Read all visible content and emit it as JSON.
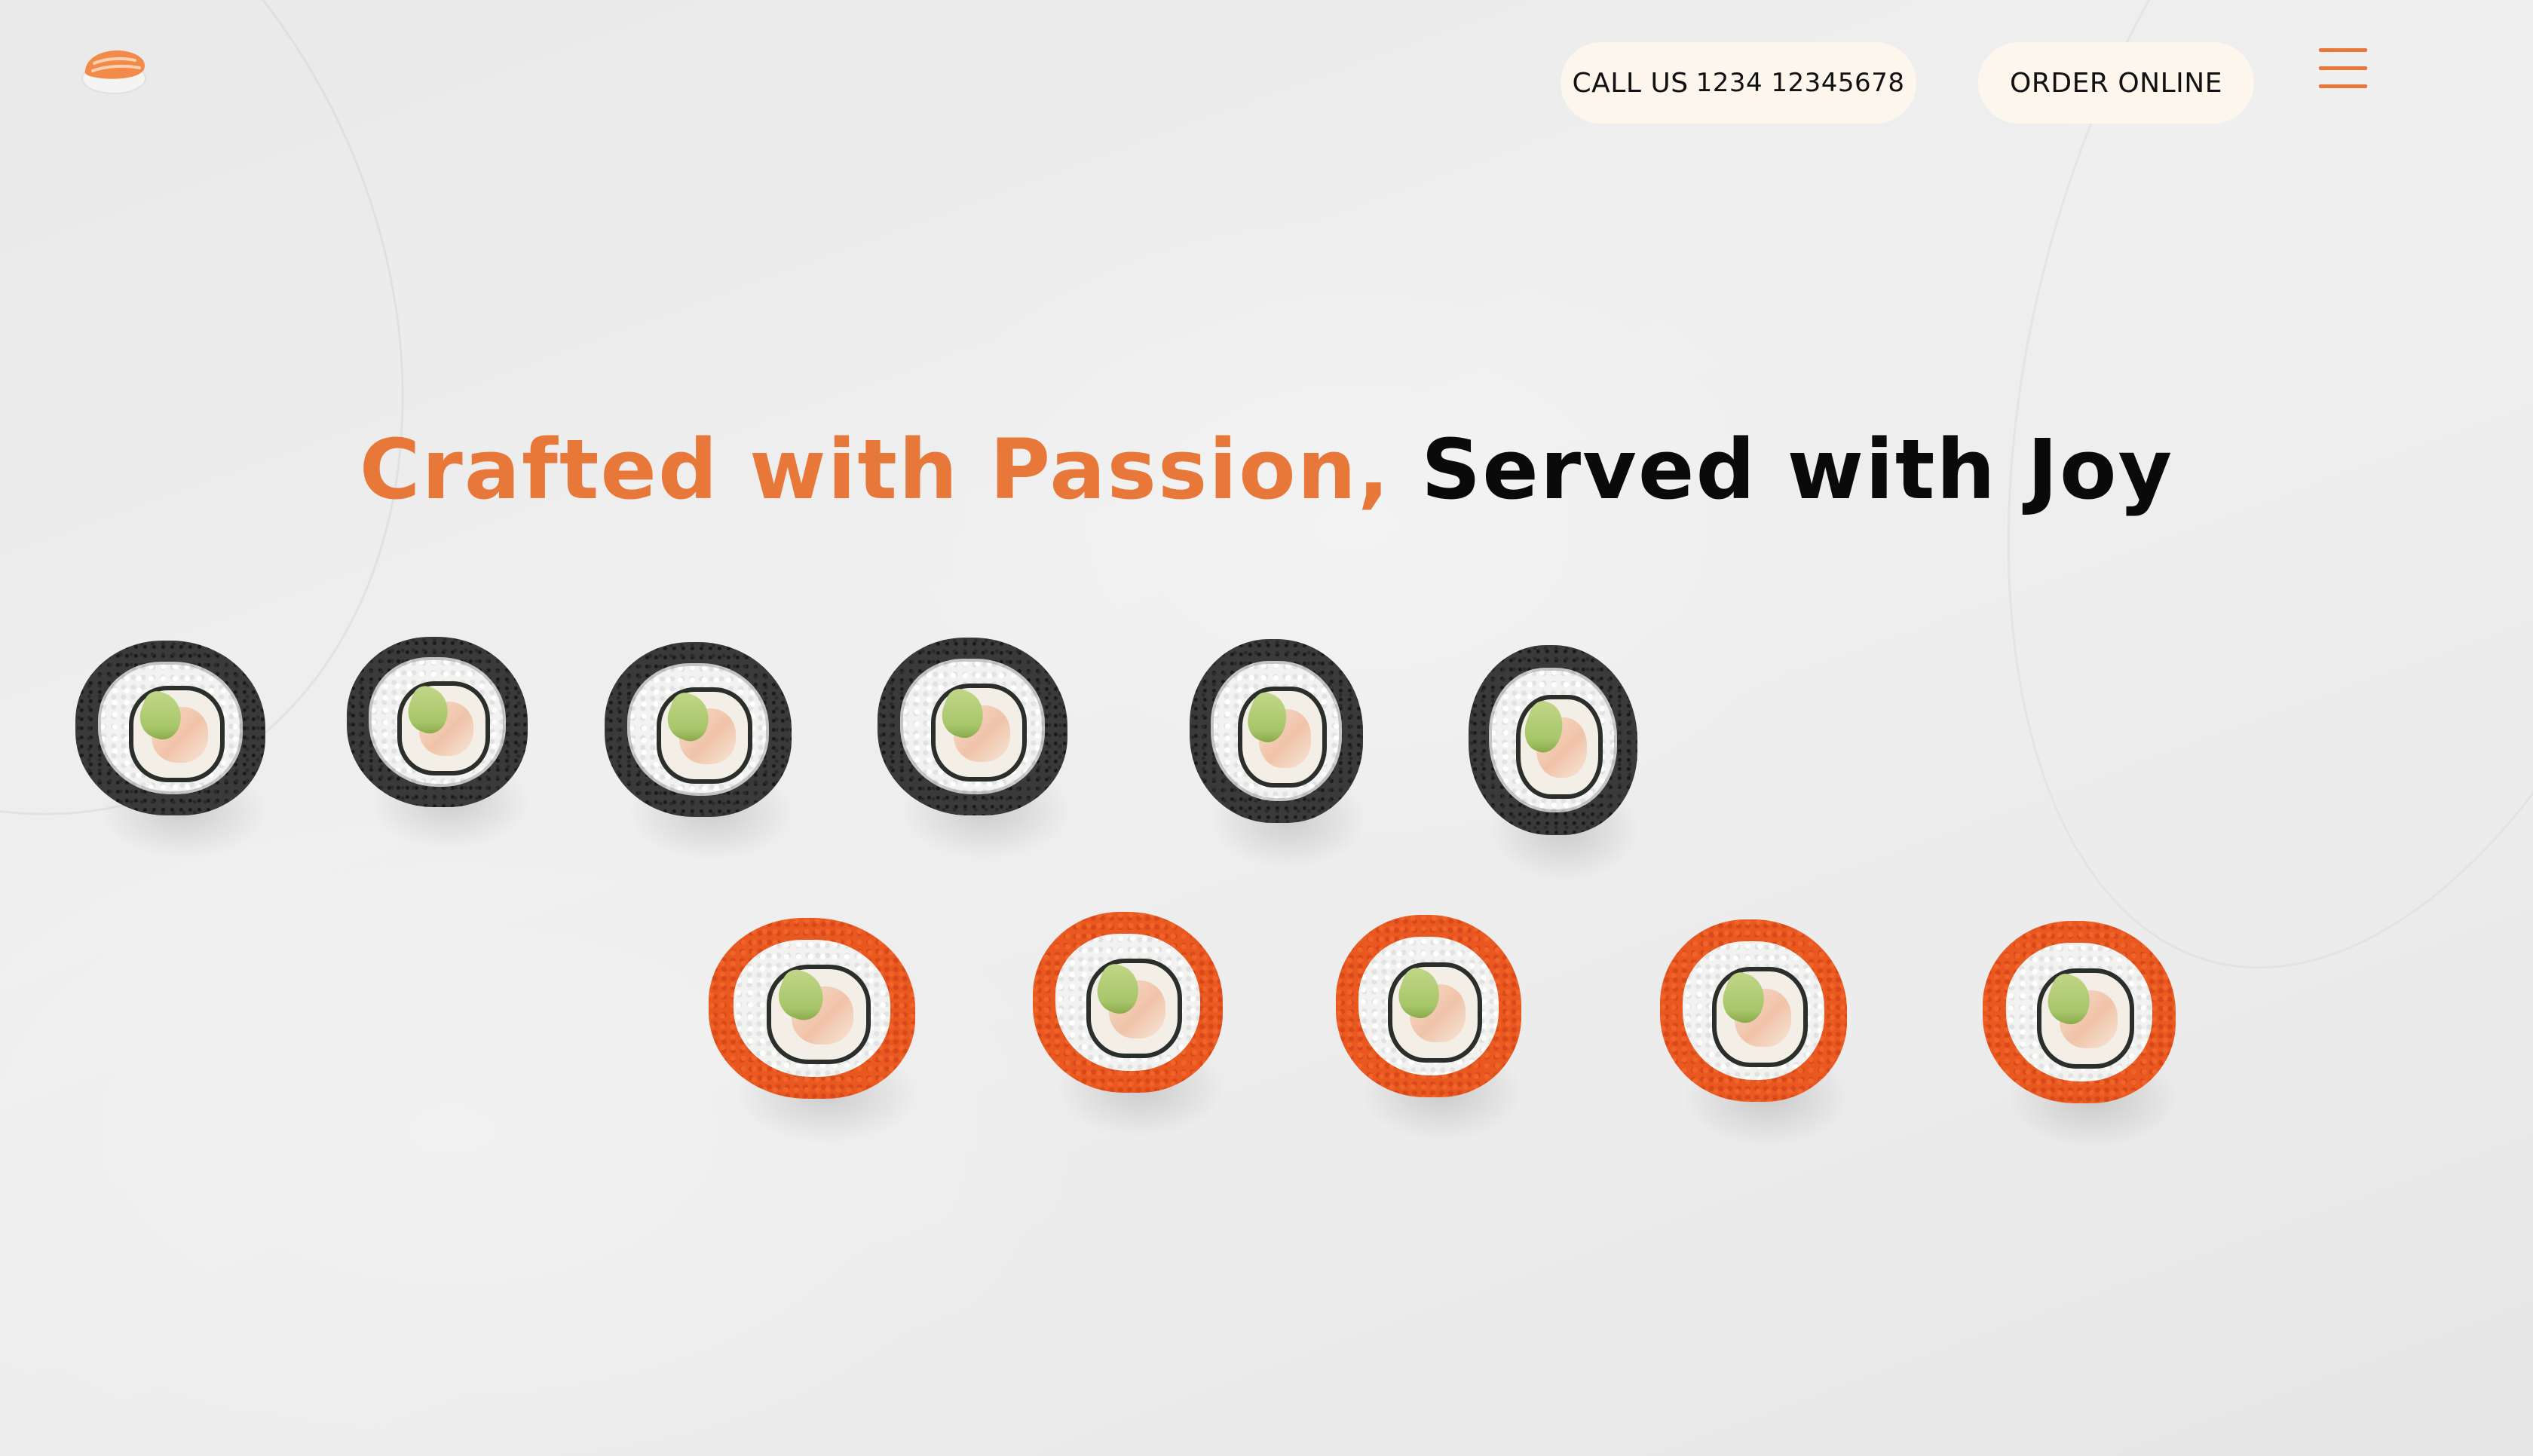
{
  "header": {
    "logo_icon": "sushi-nigiri-icon",
    "call_label": "CALL US",
    "call_number": "1234 12345678",
    "order_label": "ORDER ONLINE",
    "menu_icon": "hamburger-menu-icon"
  },
  "hero": {
    "headline_accent": "Crafted with Passion,",
    "headline_rest": "Served with Joy",
    "background": "white-marble-sushi-rolls-photo"
  },
  "colors": {
    "accent": "#e8783a",
    "pill_bg": "#fcf6ec",
    "text_dark": "#0a0a0a"
  }
}
